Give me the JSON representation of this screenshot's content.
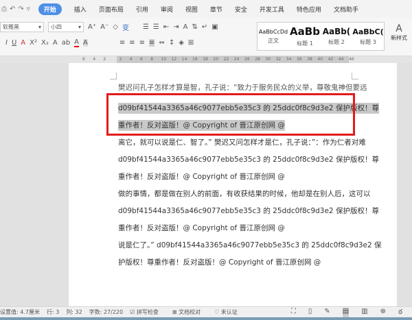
{
  "tabs": [
    "开始",
    "插入",
    "页面布局",
    "引用",
    "审阅",
    "视图",
    "章节",
    "安全",
    "开发工具",
    "特色应用",
    "文档助手"
  ],
  "toolbar": {
    "font": "软雅黑",
    "size": "小四",
    "styles": [
      {
        "preview": "AaBbCcDd",
        "label": "正文"
      },
      {
        "preview": "AaBb",
        "label": "标题 1"
      },
      {
        "preview": "AaBb(",
        "label": "标题 2"
      },
      {
        "preview": "AaBbC(",
        "label": "标题 3"
      }
    ],
    "new_style": "新样式"
  },
  "ruler": [
    "6",
    "4",
    "2",
    "2",
    "4",
    "6",
    "8",
    "10",
    "12",
    "14",
    "16",
    "18",
    "20",
    "22",
    "24",
    "26",
    "28",
    "30",
    "32",
    "34",
    "36",
    "38",
    "40",
    "42",
    "44",
    "46"
  ],
  "document": {
    "lines": [
      "樊迟问孔子怎样才算是智，孔子说：“致力于服务民众的义举，尊敬鬼神但要远",
      "d09bf41544a3365a46c9077ebb5e35c3 的 25ddc0f8c9d3e2  保护版权！尊",
      "重作者！反对盗版！@ Copyright of  晋江原创网  @",
      "离它，就可以说是仁、智了。” 樊迟又问怎样才是仁，孔子说：”：作为仁者对难",
      "d09bf41544a3365a46c9077ebb5e35c3 的 25ddc0f8c9d3e2  保护版权！尊",
      "重作者！反对盗版！@ Copyright of  晋江原创网  @",
      "做的事情，都是做在别人的前面，有收获结果的时候，他却是在别人后，这可以",
      "d09bf41544a3365a46c9077ebb5e35c3 的 25ddc0f8c9d3e2  保护版权！尊",
      "重作者！反对盗版！@ Copyright of  晋江原创网  @",
      "说是仁了。” d09bf41544a3365a46c9077ebb5e35c3 的 25ddc0f8c9d3e2  保",
      "护版权！尊重作者！反对盗版！@ Copyright of  晋江原创网  @"
    ]
  },
  "status": {
    "setting": "设置值: 4.7厘米",
    "row": "行: 3",
    "col": "列: 32",
    "words": "字数: 27/220",
    "spell": "拼写检查",
    "proof": "文档校对",
    "cert": "未认证"
  },
  "colors": {
    "accent": "#4f8fe6",
    "highlight_box": "#e21b1b"
  }
}
